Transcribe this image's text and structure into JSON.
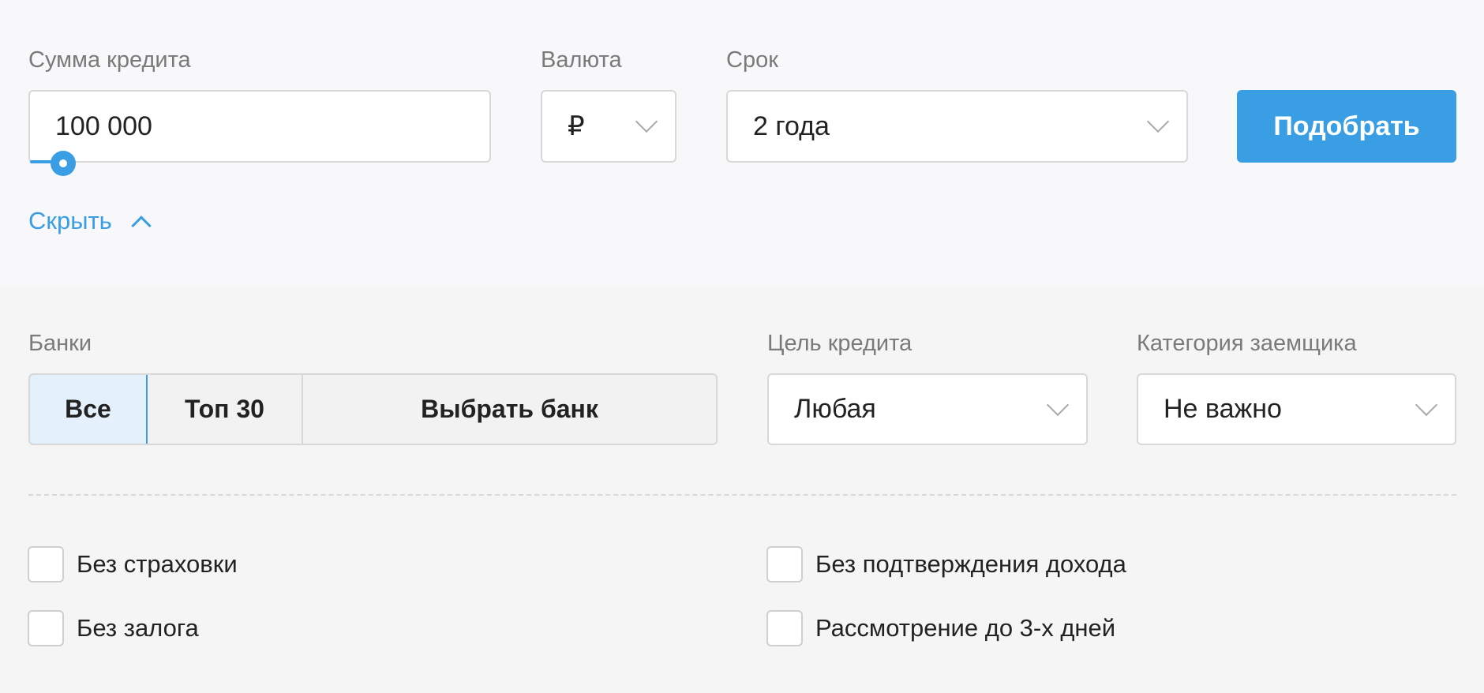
{
  "loan_amount": {
    "label": "Сумма кредита",
    "value": "100 000",
    "slider_percent": 2
  },
  "currency": {
    "label": "Валюта",
    "value": "₽"
  },
  "term": {
    "label": "Срок",
    "value": "2 года"
  },
  "submit_label": "Подобрать",
  "hide_label": "Скрыть",
  "banks": {
    "label": "Банки",
    "options": [
      "Все",
      "Топ 30",
      "Выбрать банк"
    ],
    "selected": "Все"
  },
  "purpose": {
    "label": "Цель кредита",
    "value": "Любая"
  },
  "borrower_category": {
    "label": "Категория заемщика",
    "value": "Не важно"
  },
  "checkboxes": [
    {
      "label": "Без страховки",
      "checked": false
    },
    {
      "label": "Без подтверждения дохода",
      "checked": false
    },
    {
      "label": "Без залога",
      "checked": false
    },
    {
      "label": "Рассмотрение до 3-х дней",
      "checked": false
    }
  ],
  "colors": {
    "accent": "#3a9ee4",
    "top_bg": "#f8f8fa",
    "bottom_bg": "#f5f5f5"
  }
}
